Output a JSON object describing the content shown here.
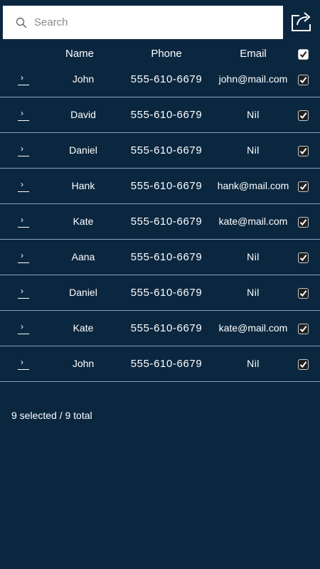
{
  "search": {
    "placeholder": "Search",
    "value": ""
  },
  "header": {
    "name_label": "Name",
    "phone_label": "Phone",
    "email_label": "Email",
    "select_all_checked": true
  },
  "rows": [
    {
      "name": "John",
      "phone": "555-610-6679",
      "email": "john@mail.com",
      "checked": true
    },
    {
      "name": "David",
      "phone": "555-610-6679",
      "email": "Nil",
      "checked": true
    },
    {
      "name": "Daniel",
      "phone": "555-610-6679",
      "email": "Nil",
      "checked": true
    },
    {
      "name": "Hank",
      "phone": "555-610-6679",
      "email": "hank@mail.com",
      "checked": true
    },
    {
      "name": "Kate",
      "phone": "555-610-6679",
      "email": "kate@mail.com",
      "checked": true
    },
    {
      "name": "Aana",
      "phone": "555-610-6679",
      "email": "Nil",
      "checked": true
    },
    {
      "name": "Daniel",
      "phone": "555-610-6679",
      "email": "Nil",
      "checked": true
    },
    {
      "name": "Kate",
      "phone": "555-610-6679",
      "email": "kate@mail.com",
      "checked": true
    },
    {
      "name": "John",
      "phone": "555-610-6679",
      "email": "Nil",
      "checked": true
    }
  ],
  "footer": {
    "summary": "9 selected / 9 total"
  },
  "colors": {
    "background": "#0b2740",
    "text": "#ffffff",
    "divider": "#8aa0b3"
  },
  "icons": {
    "search": "search-icon",
    "share": "share-icon",
    "expand": "chevron-right-icon",
    "check": "check-icon"
  }
}
